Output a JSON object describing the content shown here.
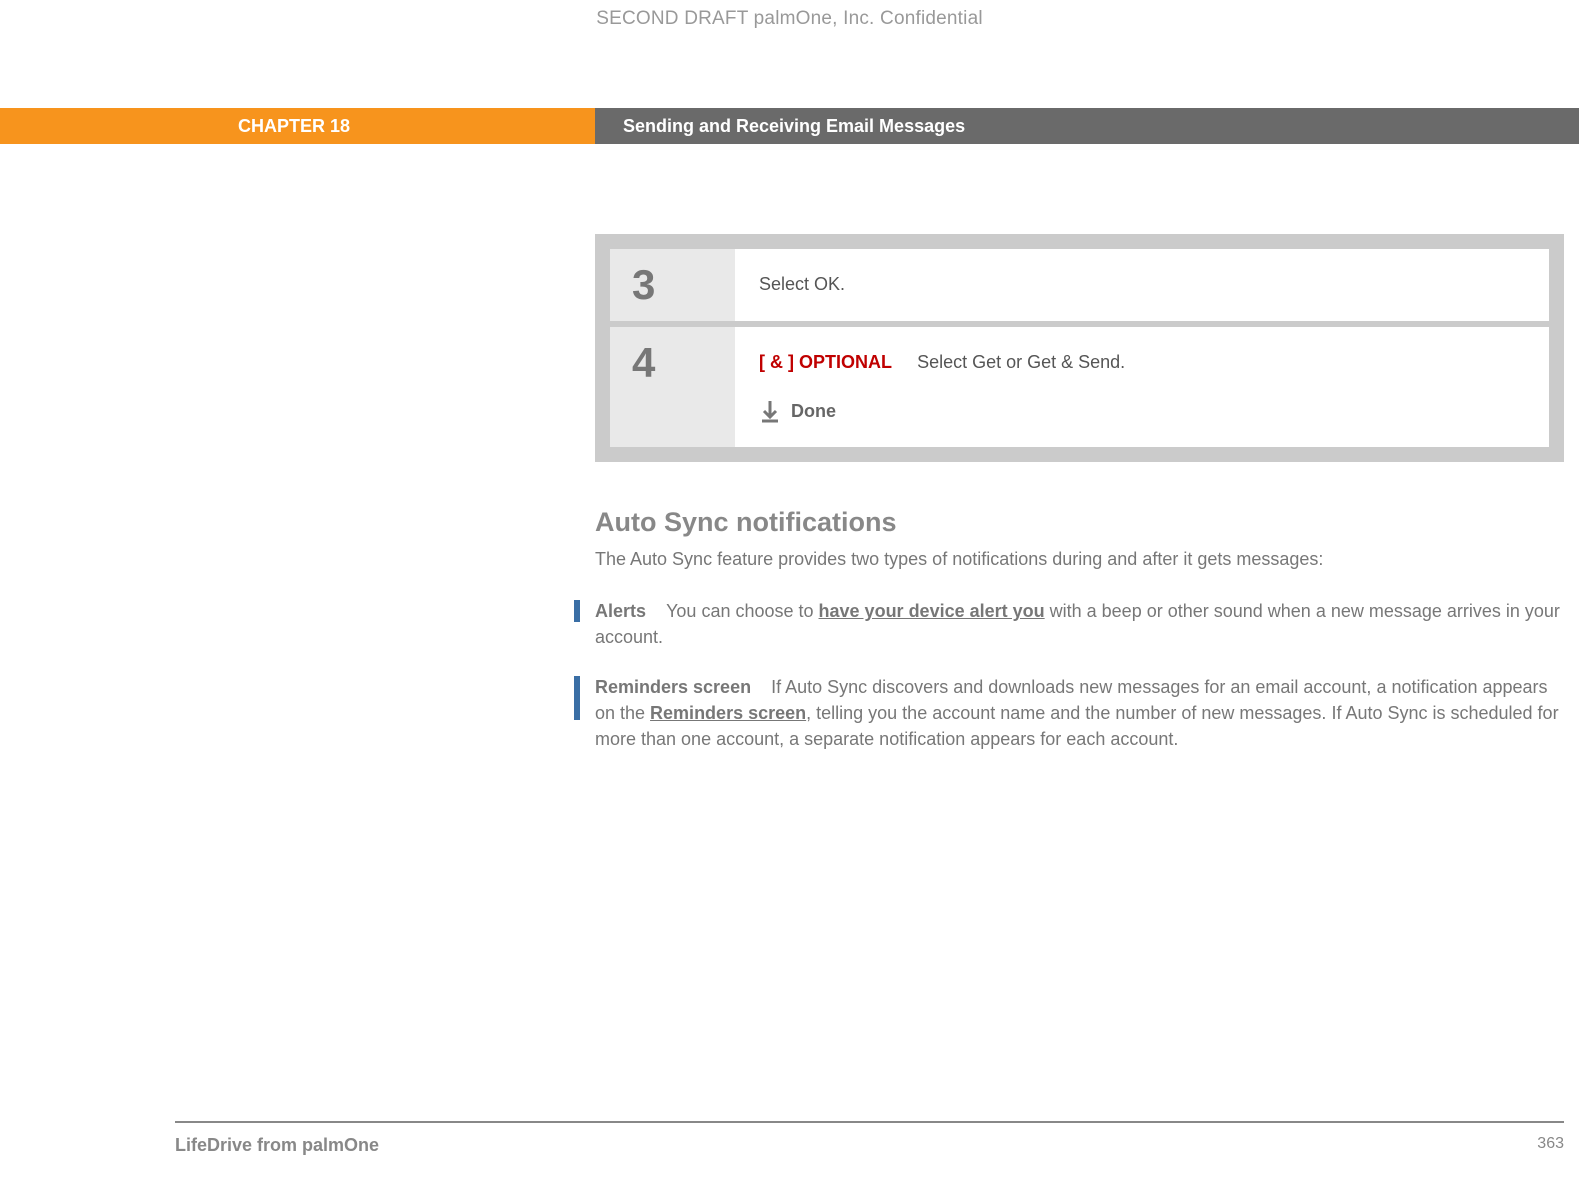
{
  "watermark": "SECOND DRAFT palmOne, Inc.  Confidential",
  "header": {
    "chapter": "CHAPTER 18",
    "title": "Sending and Receiving Email Messages"
  },
  "steps": {
    "s3": {
      "num": "3",
      "text": "Select OK."
    },
    "s4": {
      "num": "4",
      "bracket": "[ & ]",
      "optional": "OPTIONAL",
      "text": "Select Get or Get & Send.",
      "done": "Done"
    }
  },
  "section": {
    "heading": "Auto Sync notifications",
    "intro": "The Auto Sync feature provides two types of notifications during and after it gets messages:",
    "alerts": {
      "lead": "Alerts",
      "before": "You can choose to ",
      "link": "have your device alert you",
      "after": " with a beep or other sound when a new message arrives in your account."
    },
    "reminders": {
      "lead": "Reminders screen",
      "before": "If Auto Sync discovers and downloads new messages for an email account, a notification appears on the ",
      "link": "Reminders screen",
      "after": ", telling you the account name and the number of new messages. If Auto Sync is scheduled for more than one account, a separate notification appears for each account."
    }
  },
  "footer": {
    "product": "LifeDrive from palmOne",
    "page": "363"
  }
}
